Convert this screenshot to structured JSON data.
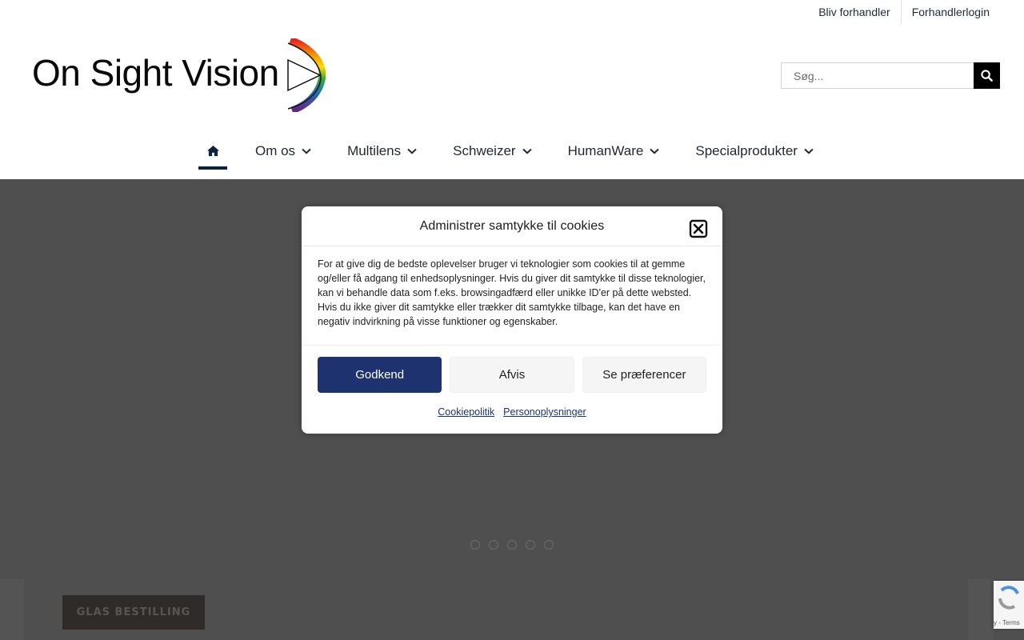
{
  "topbar": {
    "link1": "Bliv forhandler",
    "link2": "Forhandlerlogin"
  },
  "header": {
    "logo_text": "On Sight Vision",
    "search_placeholder": "Søg..."
  },
  "nav": {
    "items": [
      {
        "label": "Om os"
      },
      {
        "label": "Multilens"
      },
      {
        "label": "Schweizer"
      },
      {
        "label": "HumanWare"
      },
      {
        "label": "Specialprodukter"
      }
    ],
    "accent": "#0c2340"
  },
  "hero": {
    "slide_count": 5,
    "cta_label": "GLAS BESTILLING"
  },
  "recaptcha": {
    "text": "y - Terms"
  },
  "cookie_modal": {
    "title": "Administrer samtykke til cookies",
    "body": "For at give dig de bedste oplevelser bruger vi teknologier som cookies til at gemme og/eller få adgang til enhedsoplysninger. Hvis du giver dit samtykke til disse teknologier, kan vi behandle data som f.eks. browsingadfærd eller unikke ID'er på dette websted. Hvis du ikke giver dit samtykke eller trækker dit samtykke tilbage, kan det have en negativ indvirkning på visse funktioner og egenskaber.",
    "accept_label": "Godkend",
    "deny_label": "Afvis",
    "prefs_label": "Se præferencer",
    "link_cookie": "Cookiepolitik",
    "link_privacy": "Personoplysninger",
    "primary_color": "#1e3270"
  }
}
